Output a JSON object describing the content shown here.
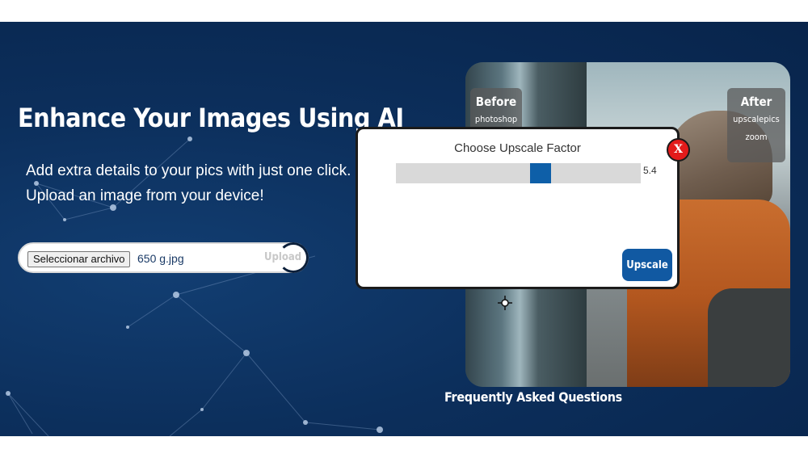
{
  "hero": {
    "headline": "Enhance Your Images Using AI",
    "subline1": "Add extra details to your pics with just one click.",
    "subline2": "Upload an image from your device!"
  },
  "upload": {
    "file_button_label": "Seleccionar archivo",
    "file_name": "650 g.jpg",
    "upload_label": "Upload"
  },
  "compare": {
    "before_label": "Before",
    "before_sub": "photoshop",
    "after_label": "After",
    "after_sub1": "upscalepics",
    "after_sub2": "zoom"
  },
  "dialog": {
    "title": "Choose Upscale Factor",
    "slider_value": "5.4",
    "slider_position_fraction": 0.6,
    "upscale_label": "Upscale",
    "close_label": "X"
  },
  "footer": {
    "faq_label": "Frequently Asked Questions"
  },
  "colors": {
    "background": "#0c2f5c",
    "accent": "#1159a2",
    "close": "#e31b1b"
  },
  "icons": {
    "close": "close-icon",
    "cursor": "move-cursor-icon"
  }
}
